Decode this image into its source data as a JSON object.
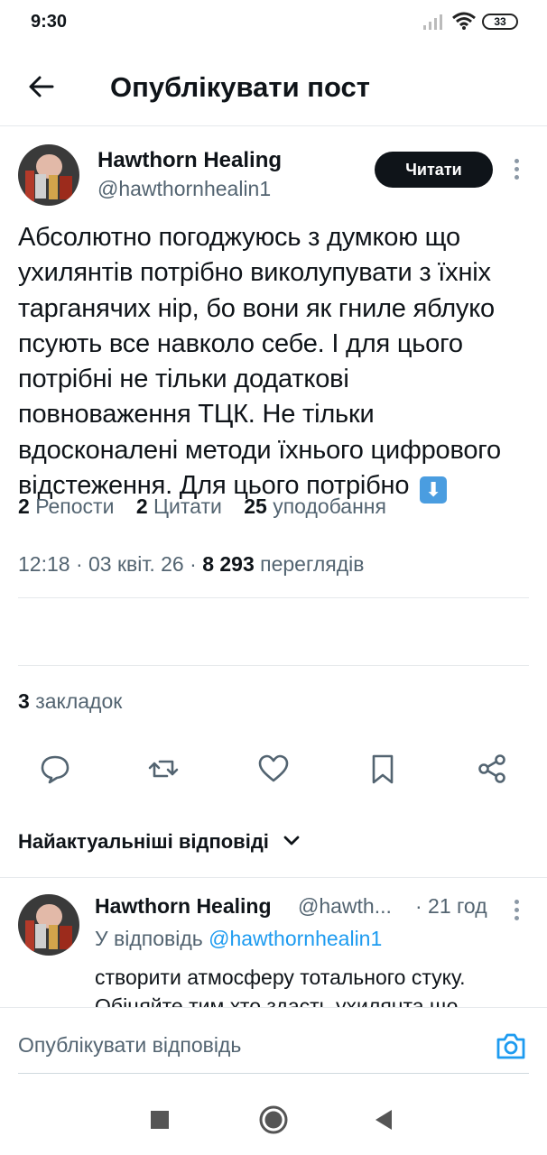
{
  "status_bar": {
    "time": "9:30",
    "battery": "33"
  },
  "header": {
    "title": "Опублікувати пост",
    "back_icon": "arrow-left-icon"
  },
  "post": {
    "author_name": "Hawthorn Healing",
    "author_handle": "@hawthornhealin1",
    "follow_label": "Читати",
    "text": "Абсолютно погоджуюсь з думкою що ухилянтів потрібно виколупувати з їхніх тарганячих нір, бо вони як гниле яблуко псують все навколо себе. І для цього потрібні не тільки додаткові повноваження ТЦК. Не тільки вдосконалені методи їхнього цифрового відстеження. Для цього потрібно",
    "emoji": "⬇",
    "time": "12:18",
    "date": "03 квіт. 26",
    "views_count": "8 293",
    "views_label": "переглядів"
  },
  "stats": {
    "reposts_count": "2",
    "reposts_label": "Репости",
    "quotes_count": "2",
    "quotes_label": "Цитати",
    "likes_count": "25",
    "likes_label": "уподобання",
    "bookmarks_count": "3",
    "bookmarks_label": "закладок"
  },
  "actions": [
    "reply-icon",
    "repost-icon",
    "like-icon",
    "bookmark-icon",
    "share-icon"
  ],
  "replies_header": {
    "label": "Найактуальніші відповіді"
  },
  "reply": {
    "author_name": "Hawthorn Healing",
    "author_handle": "@hawth...",
    "time": "· 21 год",
    "replying_to_prefix": "У відповідь",
    "replying_to_handle": "@hawthornhealin1",
    "text_line1": "створити атмосферу тотального стуку.",
    "text_line2": "Обіцяйте тим хто здасть ухилянта що"
  },
  "composer": {
    "placeholder": "Опублікувати відповідь"
  },
  "colors": {
    "accent": "#1d9bf0",
    "text": "#0f1419",
    "secondary": "#536471"
  }
}
